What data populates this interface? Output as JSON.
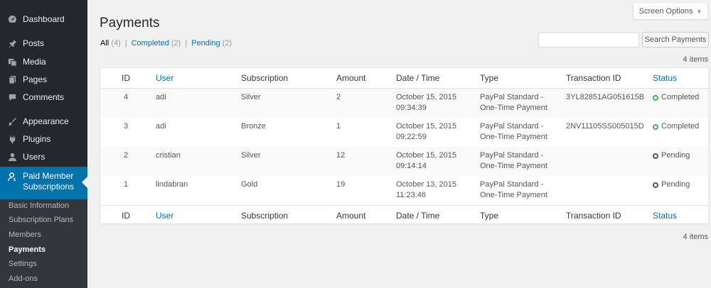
{
  "sidebar": {
    "items": [
      {
        "label": "Dashboard",
        "icon": "dashboard-icon"
      },
      {
        "label": "Posts",
        "icon": "pin-icon"
      },
      {
        "label": "Media",
        "icon": "media-icon"
      },
      {
        "label": "Pages",
        "icon": "pages-icon"
      },
      {
        "label": "Comments",
        "icon": "comment-icon"
      },
      {
        "label": "Appearance",
        "icon": "brush-icon"
      },
      {
        "label": "Plugins",
        "icon": "plugin-icon"
      },
      {
        "label": "Users",
        "icon": "users-icon"
      }
    ],
    "active": {
      "label_line1": "Paid Member",
      "label_line2": "Subscriptions",
      "icon": "member-icon"
    },
    "submenu": [
      "Basic Information",
      "Subscription Plans",
      "Members",
      "Payments",
      "Settings",
      "Add-ons"
    ]
  },
  "header": {
    "title": "Payments",
    "screen_options": "Screen Options"
  },
  "filters": {
    "all": "All",
    "all_count": "(4)",
    "completed": "Completed",
    "completed_count": "(2)",
    "pending": "Pending",
    "pending_count": "(2)",
    "separator": "|"
  },
  "search": {
    "button": "Search Payments",
    "value": ""
  },
  "items_count": "4 items",
  "table": {
    "columns": [
      "ID",
      "User",
      "Subscription",
      "Amount",
      "Date / Time",
      "Type",
      "Transaction ID",
      "Status"
    ],
    "rows": [
      {
        "id": "4",
        "user": "adi",
        "subscription": "Silver",
        "amount": "2",
        "date": "October 15, 2015",
        "time": "09:34:39",
        "type1": "PayPal Standard -",
        "type2": "One-Time Payment",
        "txn": "3YL82851AG051615B",
        "status": "Completed"
      },
      {
        "id": "3",
        "user": "adi",
        "subscription": "Bronze",
        "amount": "1",
        "date": "October 15, 2015",
        "time": "09:22:59",
        "type1": "PayPal Standard -",
        "type2": "One-Time Payment",
        "txn": "2NV11105SS005015D",
        "status": "Completed"
      },
      {
        "id": "2",
        "user": "cristian",
        "subscription": "Silver",
        "amount": "12",
        "date": "October 15, 2015",
        "time": "09:14:14",
        "type1": "PayPal Standard -",
        "type2": "One-Time Payment",
        "txn": "",
        "status": "Pending"
      },
      {
        "id": "1",
        "user": "lindabran",
        "subscription": "Gold",
        "amount": "19",
        "date": "October 13, 2015",
        "time": "11:23:46",
        "type1": "PayPal Standard -",
        "type2": "One-Time Payment",
        "txn": "",
        "status": "Pending"
      }
    ]
  },
  "colors": {
    "sidebar": "#23282d",
    "active": "#0073aa",
    "completed": "#46b450",
    "link": "#0073aa"
  }
}
